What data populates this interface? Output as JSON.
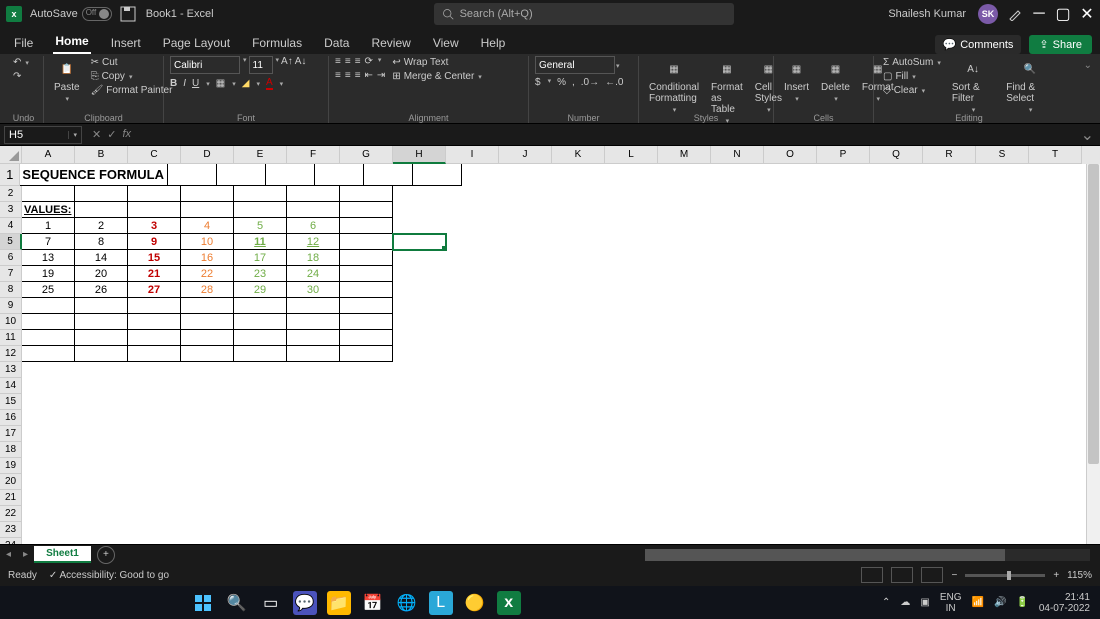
{
  "titlebar": {
    "autosave_label": "AutoSave",
    "autosave_state": "Off",
    "doc_title": "Book1 - Excel",
    "search_placeholder": "Search (Alt+Q)",
    "user_name": "Shailesh Kumar",
    "user_initials": "SK"
  },
  "tabs": [
    "File",
    "Home",
    "Insert",
    "Page Layout",
    "Formulas",
    "Data",
    "Review",
    "View",
    "Help"
  ],
  "active_tab": "Home",
  "actions": {
    "comments": "Comments",
    "share": "Share"
  },
  "ribbon": {
    "undo": "Undo",
    "paste": "Paste",
    "cut": "Cut",
    "copy": "Copy",
    "format_painter": "Format Painter",
    "clipboard": "Clipboard",
    "font_name": "Calibri",
    "font_size": "11",
    "font_group": "Font",
    "wrap": "Wrap Text",
    "merge": "Merge & Center",
    "alignment": "Alignment",
    "number_format": "General",
    "number": "Number",
    "cond": "Conditional Formatting",
    "tbl": "Format as Table",
    "cell_styles": "Cell Styles",
    "styles": "Styles",
    "insert": "Insert",
    "delete": "Delete",
    "format": "Format",
    "cells": "Cells",
    "autosum": "AutoSum",
    "fill": "Fill",
    "clear": "Clear",
    "sort": "Sort & Filter",
    "find": "Find & Select",
    "editing": "Editing"
  },
  "namebox": "H5",
  "formula": "",
  "columns": [
    "A",
    "B",
    "C",
    "D",
    "E",
    "F",
    "G",
    "H",
    "I",
    "J",
    "K",
    "L",
    "M",
    "N",
    "O",
    "P",
    "Q",
    "R",
    "S",
    "T"
  ],
  "active_col": "H",
  "active_row": 5,
  "cells": {
    "A1": {
      "v": "SEQUENCE FORMULA :",
      "cls": "b left",
      "span": 3
    },
    "A3": {
      "v": "VALUES:",
      "cls": "b u left"
    },
    "A4": {
      "v": "1"
    },
    "B4": {
      "v": "2"
    },
    "C4": {
      "v": "3",
      "cls": "red"
    },
    "D4": {
      "v": "4",
      "cls": "orng"
    },
    "E4": {
      "v": "5",
      "cls": "grn"
    },
    "F4": {
      "v": "6",
      "cls": "grn"
    },
    "A5": {
      "v": "7"
    },
    "B5": {
      "v": "8"
    },
    "C5": {
      "v": "9",
      "cls": "red"
    },
    "D5": {
      "v": "10",
      "cls": "orng"
    },
    "E5": {
      "v": "11",
      "cls": "grn u b"
    },
    "F5": {
      "v": "12",
      "cls": "grn u"
    },
    "A6": {
      "v": "13"
    },
    "B6": {
      "v": "14"
    },
    "C6": {
      "v": "15",
      "cls": "red"
    },
    "D6": {
      "v": "16",
      "cls": "orng"
    },
    "E6": {
      "v": "17",
      "cls": "grn"
    },
    "F6": {
      "v": "18",
      "cls": "grn"
    },
    "A7": {
      "v": "19"
    },
    "B7": {
      "v": "20"
    },
    "C7": {
      "v": "21",
      "cls": "red"
    },
    "D7": {
      "v": "22",
      "cls": "orng"
    },
    "E7": {
      "v": "23",
      "cls": "grn"
    },
    "F7": {
      "v": "24",
      "cls": "grn"
    },
    "A8": {
      "v": "25"
    },
    "B8": {
      "v": "26"
    },
    "C8": {
      "v": "27",
      "cls": "red"
    },
    "D8": {
      "v": "28",
      "cls": "orng"
    },
    "E8": {
      "v": "29",
      "cls": "grn"
    },
    "F8": {
      "v": "30",
      "cls": "grn"
    }
  },
  "bordered_region": {
    "r1": 1,
    "r2": 12,
    "c1": "A",
    "c2": "G"
  },
  "chart_data": {
    "type": "table",
    "title": "SEQUENCE FORMULA :",
    "rows": [
      [
        1,
        2,
        3,
        4,
        5,
        6
      ],
      [
        7,
        8,
        9,
        10,
        11,
        12
      ],
      [
        13,
        14,
        15,
        16,
        17,
        18
      ],
      [
        19,
        20,
        21,
        22,
        23,
        24
      ],
      [
        25,
        26,
        27,
        28,
        29,
        30
      ]
    ]
  },
  "sheet": {
    "name": "Sheet1"
  },
  "status": {
    "ready": "Ready",
    "access": "Accessibility: Good to go",
    "zoom": "115%"
  },
  "taskbar": {
    "lang1": "ENG",
    "lang2": "IN",
    "time": "21:41",
    "date": "04-07-2022"
  }
}
